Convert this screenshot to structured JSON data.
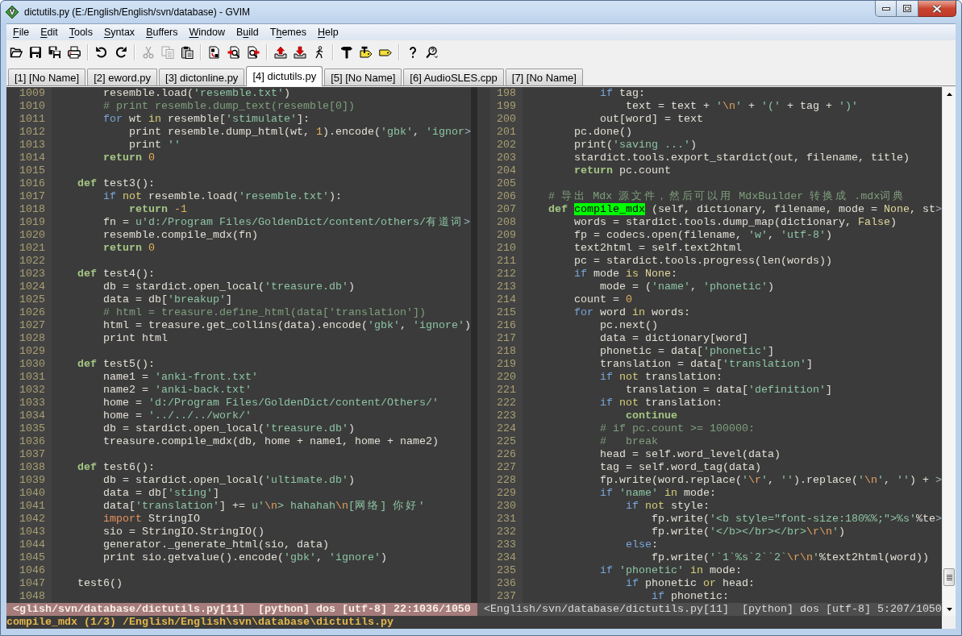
{
  "window": {
    "title": "dictutils.py (E:/English/English/svn/database) - GVIM"
  },
  "menu": [
    {
      "label": "File",
      "kind": "first"
    },
    {
      "label": "Edit",
      "kind": "first"
    },
    {
      "label": "Tools",
      "kind": "first"
    },
    {
      "label": "Syntax",
      "kind": "first"
    },
    {
      "label": "Buffers",
      "kind": "first"
    },
    {
      "label": "Window",
      "kind": "first"
    },
    {
      "label": "Build",
      "kind": "second"
    },
    {
      "label": "Themes",
      "kind": "second"
    },
    {
      "label": "Help",
      "kind": "first"
    }
  ],
  "toolbar": {
    "groups": [
      {
        "buttons": [
          {
            "disabled": false
          },
          {
            "disabled": false
          },
          {
            "disabled": false
          },
          {
            "disabled": false
          }
        ]
      },
      {
        "buttons": [
          {
            "disabled": false
          },
          {
            "disabled": false
          }
        ]
      },
      {
        "buttons": [
          {
            "disabled": true
          },
          {
            "disabled": true
          },
          {
            "disabled": false
          }
        ]
      },
      {
        "buttons": [
          {
            "disabled": false
          },
          {
            "disabled": false
          },
          {
            "disabled": false
          }
        ]
      },
      {
        "buttons": [
          {
            "disabled": false
          },
          {
            "disabled": false
          },
          {
            "disabled": false
          }
        ]
      },
      {
        "buttons": [
          {
            "disabled": false
          },
          {
            "disabled": false
          },
          {
            "disabled": false
          }
        ]
      },
      {
        "buttons": [
          {
            "disabled": false
          },
          {
            "disabled": false
          }
        ]
      }
    ]
  },
  "tabs": [
    {
      "label": "[1] [No Name]",
      "selected": false
    },
    {
      "label": "[2] eword.py",
      "selected": false
    },
    {
      "label": "[3] dictonline.py",
      "selected": false
    },
    {
      "label": "[4] dictutils.py",
      "selected": true
    },
    {
      "label": "[5] [No Name]",
      "selected": false
    },
    {
      "label": "[6] AudioSLES.cpp",
      "selected": false
    },
    {
      "label": "[7] [No Name]",
      "selected": false
    }
  ],
  "panes": [
    {
      "active": true,
      "lines": [
        {
          "number": "1009",
          "segments": [
            "        resemble.load(",
            {
              "kind": "string",
              "text": "'resemble.txt'"
            },
            ")"
          ]
        },
        {
          "number": "1010",
          "segments": [
            {
              "kind": "comment",
              "text": "        # print resemble.dump_text(resemble[0])"
            }
          ]
        },
        {
          "number": "1011",
          "segments": [
            {
              "kind": "statement",
              "text": "        for"
            },
            " wt ",
            {
              "kind": "operator",
              "text": "in"
            },
            " resemble[",
            {
              "kind": "string",
              "text": "'stimulate'"
            },
            "]:"
          ]
        },
        {
          "number": "1012",
          "segments": [
            "            print resemble.dump_html(wt, ",
            {
              "kind": "number",
              "text": "1"
            },
            ").encode(",
            {
              "kind": "string",
              "text": "'gbk'"
            },
            ", ",
            {
              "kind": "string",
              "text": "'ignor"
            },
            {
              "kind": "extends",
              "text": ">"
            }
          ]
        },
        {
          "number": "1013",
          "segments": [
            "            print ",
            {
              "kind": "string",
              "text": "''"
            }
          ]
        },
        {
          "number": "1014",
          "segments": [
            {
              "kind": "define",
              "text": "        return"
            },
            {
              "kind": "number",
              "text": " 0"
            }
          ]
        },
        {
          "number": "1015"
        },
        {
          "number": "1016",
          "segments": [
            {
              "kind": "define",
              "text": "    def"
            },
            " test3():"
          ]
        },
        {
          "number": "1017",
          "segments": [
            {
              "kind": "statement",
              "text": "        if"
            },
            {
              "kind": "operator",
              "text": " not"
            },
            " resemble.load(",
            {
              "kind": "string",
              "text": "'resemble.txt'"
            },
            "):"
          ]
        },
        {
          "number": "1018",
          "segments": [
            {
              "kind": "define",
              "text": "            return"
            },
            {
              "kind": "number",
              "text": " -1"
            }
          ]
        },
        {
          "number": "1019",
          "segments": [
            "        fn = ",
            {
              "kind": "string",
              "text": "u'd:/Program Files/GoldenDict/content/others/有道词"
            },
            {
              "kind": "extends",
              "text": ">"
            }
          ]
        },
        {
          "number": "1020",
          "segments": [
            "        resemble.compile_mdx(fn)"
          ]
        },
        {
          "number": "1021",
          "segments": [
            {
              "kind": "define",
              "text": "        return"
            },
            {
              "kind": "number",
              "text": " 0"
            }
          ]
        },
        {
          "number": "1022"
        },
        {
          "number": "1023",
          "segments": [
            {
              "kind": "define",
              "text": "    def"
            },
            " test4():"
          ]
        },
        {
          "number": "1024",
          "segments": [
            "        db = stardict.open_local(",
            {
              "kind": "string",
              "text": "'treasure.db'"
            },
            ")"
          ]
        },
        {
          "number": "1025",
          "segments": [
            "        data = db[",
            {
              "kind": "string",
              "text": "'breakup'"
            },
            "]"
          ]
        },
        {
          "number": "1026",
          "segments": [
            {
              "kind": "comment",
              "text": "        # html = treasure.define_html(data['translation'])"
            }
          ]
        },
        {
          "number": "1027",
          "segments": [
            "        html = treasure.get_collins(data).encode(",
            {
              "kind": "string",
              "text": "'gbk'"
            },
            ", ",
            {
              "kind": "string",
              "text": "'ignore'"
            },
            ")"
          ]
        },
        {
          "number": "1028",
          "segments": [
            "        print html"
          ]
        },
        {
          "number": "1029"
        },
        {
          "number": "1030",
          "segments": [
            {
              "kind": "define",
              "text": "    def"
            },
            " test5():"
          ]
        },
        {
          "number": "1031",
          "segments": [
            "        name1 = ",
            {
              "kind": "string",
              "text": "'anki-front.txt'"
            }
          ]
        },
        {
          "number": "1032",
          "segments": [
            "        name2 = ",
            {
              "kind": "string",
              "text": "'anki-back.txt'"
            }
          ]
        },
        {
          "number": "1033",
          "segments": [
            "        home = ",
            {
              "kind": "string",
              "text": "'d:/Program Files/GoldenDict/content/Others/'"
            }
          ]
        },
        {
          "number": "1034",
          "segments": [
            "        home = ",
            {
              "kind": "string",
              "text": "'../../../work/'"
            }
          ]
        },
        {
          "number": "1035",
          "segments": [
            "        db = stardict.open_local(",
            {
              "kind": "string",
              "text": "'treasure.db'"
            },
            ")"
          ]
        },
        {
          "number": "1036",
          "segments": [
            "        treasure.compile_mdx(db, home + name1, home + name2)"
          ]
        },
        {
          "number": "1037"
        },
        {
          "number": "1038",
          "segments": [
            {
              "kind": "define",
              "text": "    def"
            },
            " test6():"
          ]
        },
        {
          "number": "1039",
          "segments": [
            "        db = stardict.open_local(",
            {
              "kind": "string",
              "text": "'ultimate.db'"
            },
            ")"
          ]
        },
        {
          "number": "1040",
          "segments": [
            "        data = db[",
            {
              "kind": "string",
              "text": "'sting'"
            },
            "]"
          ]
        },
        {
          "number": "1041",
          "segments": [
            "        data[",
            {
              "kind": "string",
              "text": "'translation'"
            },
            "] += ",
            {
              "kind": "string",
              "text": "u'"
            },
            {
              "kind": "escape",
              "text": "\\n"
            },
            {
              "kind": "string",
              "text": "> hahahah"
            },
            {
              "kind": "escape",
              "text": "\\n"
            },
            {
              "kind": "string",
              "text": "[网络] 你好'"
            }
          ]
        },
        {
          "number": "1042",
          "segments": [
            {
              "kind": "import",
              "text": "        import"
            },
            " StringIO"
          ]
        },
        {
          "number": "1043",
          "segments": [
            "        sio = StringIO.StringIO()"
          ]
        },
        {
          "number": "1044",
          "segments": [
            "        generator._generate_html(sio, data)"
          ]
        },
        {
          "number": "1045",
          "segments": [
            "        print sio.getvalue().encode(",
            {
              "kind": "string",
              "text": "'gbk'"
            },
            ", ",
            {
              "kind": "string",
              "text": "'ignore'"
            },
            ")"
          ]
        },
        {
          "number": "1046"
        },
        {
          "number": "1047",
          "segments": [
            "    test6()"
          ]
        },
        {
          "number": "1048"
        }
      ],
      "status": "<glish/svn/database/dictutils.py[11]  [python] dos [utf-8] 22:1036/1050"
    },
    {
      "active": false,
      "lines": [
        {
          "number": "198",
          "segments": [
            {
              "kind": "statement",
              "text": "            if"
            },
            " tag:"
          ]
        },
        {
          "number": "199",
          "segments": [
            "                text = text + ",
            {
              "kind": "string",
              "text": "'"
            },
            {
              "kind": "escape",
              "text": "\\n"
            },
            {
              "kind": "string",
              "text": "'"
            },
            " + ",
            {
              "kind": "string",
              "text": "'('"
            },
            " + tag + ",
            {
              "kind": "string",
              "text": "')'"
            }
          ]
        },
        {
          "number": "200",
          "segments": [
            "            out[word] = text"
          ]
        },
        {
          "number": "201",
          "segments": [
            "        pc.done()"
          ]
        },
        {
          "number": "202",
          "segments": [
            "        print(",
            {
              "kind": "string",
              "text": "'saving ...'"
            },
            ")"
          ]
        },
        {
          "number": "203",
          "segments": [
            "        stardict.tools.export_stardict(out, filename, title)"
          ]
        },
        {
          "number": "204",
          "segments": [
            {
              "kind": "define",
              "text": "        return"
            },
            " pc.count"
          ]
        },
        {
          "number": "205"
        },
        {
          "number": "206",
          "segments": [
            {
              "kind": "comment",
              "text": "    # 导出 Mdx 源文件，然后可以用 MdxBuilder 转换成 .mdx词典"
            }
          ]
        },
        {
          "number": "207",
          "segments": [
            {
              "kind": "define",
              "text": "    def "
            },
            {
              "kind": "search",
              "text": "compile_mdx"
            },
            " (self, dictionary, filename, mode = ",
            {
              "kind": "constant",
              "text": "None"
            },
            ", st",
            {
              "kind": "extends",
              "text": ">"
            }
          ]
        },
        {
          "number": "208",
          "segments": [
            "        words = stardict.tools.dump_map(dictionary, ",
            {
              "kind": "constant",
              "text": "False"
            },
            ")"
          ]
        },
        {
          "number": "209",
          "segments": [
            "        fp = codecs.open(filename, ",
            {
              "kind": "string",
              "text": "'w'"
            },
            ", ",
            {
              "kind": "string",
              "text": "'utf-8'"
            },
            ")"
          ]
        },
        {
          "number": "210",
          "segments": [
            "        text2html = self.text2html"
          ]
        },
        {
          "number": "211",
          "segments": [
            "        pc = stardict.tools.progress(len(words))"
          ]
        },
        {
          "number": "212",
          "segments": [
            {
              "kind": "statement",
              "text": "        if"
            },
            " mode ",
            {
              "kind": "operator",
              "text": "is"
            },
            {
              "kind": "constant",
              "text": " None"
            },
            ":"
          ]
        },
        {
          "number": "213",
          "segments": [
            "            mode = (",
            {
              "kind": "string",
              "text": "'name'"
            },
            ", ",
            {
              "kind": "string",
              "text": "'phonetic'"
            },
            ")"
          ]
        },
        {
          "number": "214",
          "segments": [
            "        count = ",
            {
              "kind": "number",
              "text": "0"
            }
          ]
        },
        {
          "number": "215",
          "segments": [
            {
              "kind": "statement",
              "text": "        for"
            },
            " word ",
            {
              "kind": "operator",
              "text": "in"
            },
            " words:"
          ]
        },
        {
          "number": "216",
          "segments": [
            "            pc.next()"
          ]
        },
        {
          "number": "217",
          "segments": [
            "            data = dictionary[word]"
          ]
        },
        {
          "number": "218",
          "segments": [
            "            phonetic = data[",
            {
              "kind": "string",
              "text": "'phonetic'"
            },
            "]"
          ]
        },
        {
          "number": "219",
          "segments": [
            "            translation = data[",
            {
              "kind": "string",
              "text": "'translation'"
            },
            "]"
          ]
        },
        {
          "number": "220",
          "segments": [
            {
              "kind": "statement",
              "text": "            if"
            },
            {
              "kind": "operator",
              "text": " not"
            },
            " translation:"
          ]
        },
        {
          "number": "221",
          "segments": [
            "                translation = data[",
            {
              "kind": "string",
              "text": "'definition'"
            },
            "]"
          ]
        },
        {
          "number": "222",
          "segments": [
            {
              "kind": "statement",
              "text": "            if"
            },
            {
              "kind": "operator",
              "text": " not"
            },
            " translation:"
          ]
        },
        {
          "number": "223",
          "segments": [
            {
              "kind": "define",
              "text": "                continue"
            }
          ]
        },
        {
          "number": "224",
          "segments": [
            {
              "kind": "comment",
              "text": "            # if pc.count >= 100000:"
            }
          ]
        },
        {
          "number": "225",
          "segments": [
            {
              "kind": "comment",
              "text": "            #   break"
            }
          ]
        },
        {
          "number": "226",
          "segments": [
            "            head = self.word_level(data)"
          ]
        },
        {
          "number": "227",
          "segments": [
            "            tag = self.word_tag(data)"
          ]
        },
        {
          "number": "228",
          "segments": [
            "            fp.write(word.replace(",
            {
              "kind": "string",
              "text": "'"
            },
            {
              "kind": "escape",
              "text": "\\r"
            },
            {
              "kind": "string",
              "text": "'"
            },
            ", ",
            {
              "kind": "string",
              "text": "''"
            },
            ").replace(",
            {
              "kind": "string",
              "text": "'"
            },
            {
              "kind": "escape",
              "text": "\\n"
            },
            {
              "kind": "string",
              "text": "'"
            },
            ", ",
            {
              "kind": "string",
              "text": "''"
            },
            ") + ",
            {
              "kind": "extends",
              "text": ">"
            }
          ]
        },
        {
          "number": "229",
          "segments": [
            {
              "kind": "statement",
              "text": "            if"
            },
            {
              "kind": "string",
              "text": " 'name'"
            },
            {
              "kind": "operator",
              "text": " in"
            },
            " mode:"
          ]
        },
        {
          "number": "230",
          "segments": [
            {
              "kind": "statement",
              "text": "                if"
            },
            {
              "kind": "operator",
              "text": " not"
            },
            " style:"
          ]
        },
        {
          "number": "231",
          "segments": [
            "                    fp.write(",
            {
              "kind": "string",
              "text": "'<b style=\"font-size:180%%;\">%s'"
            },
            "%te",
            {
              "kind": "extends",
              "text": ">"
            }
          ]
        },
        {
          "number": "232",
          "segments": [
            "                    fp.write(",
            {
              "kind": "string",
              "text": "'</b></br></br>"
            },
            {
              "kind": "escape",
              "text": "\\r\\n"
            },
            {
              "kind": "string",
              "text": "'"
            },
            ")"
          ]
        },
        {
          "number": "233",
          "segments": [
            {
              "kind": "statement",
              "text": "                else"
            },
            ":"
          ]
        },
        {
          "number": "234",
          "segments": [
            "                    fp.write(",
            {
              "kind": "string",
              "text": "'`1`%s`2``2`"
            },
            {
              "kind": "escape",
              "text": "\\r\\n"
            },
            {
              "kind": "string",
              "text": "'"
            },
            "%text2html(word))"
          ]
        },
        {
          "number": "235",
          "segments": [
            {
              "kind": "statement",
              "text": "            if"
            },
            {
              "kind": "string",
              "text": " 'phonetic'"
            },
            {
              "kind": "operator",
              "text": " in"
            },
            " mode:"
          ]
        },
        {
          "number": "236",
          "segments": [
            {
              "kind": "statement",
              "text": "                if"
            },
            " phonetic ",
            {
              "kind": "operator",
              "text": "or"
            },
            " head:"
          ]
        },
        {
          "number": "237",
          "segments": [
            {
              "kind": "statement",
              "text": "                    if"
            },
            " phonetic:"
          ]
        }
      ],
      "status": "<English/svn/database/dictutils.py[11]  [python] dos [utf-8] 5:207/1050"
    }
  ],
  "command_line": "compile_mdx (1/3) /English/English\\svn\\database\\dictutils.py"
}
